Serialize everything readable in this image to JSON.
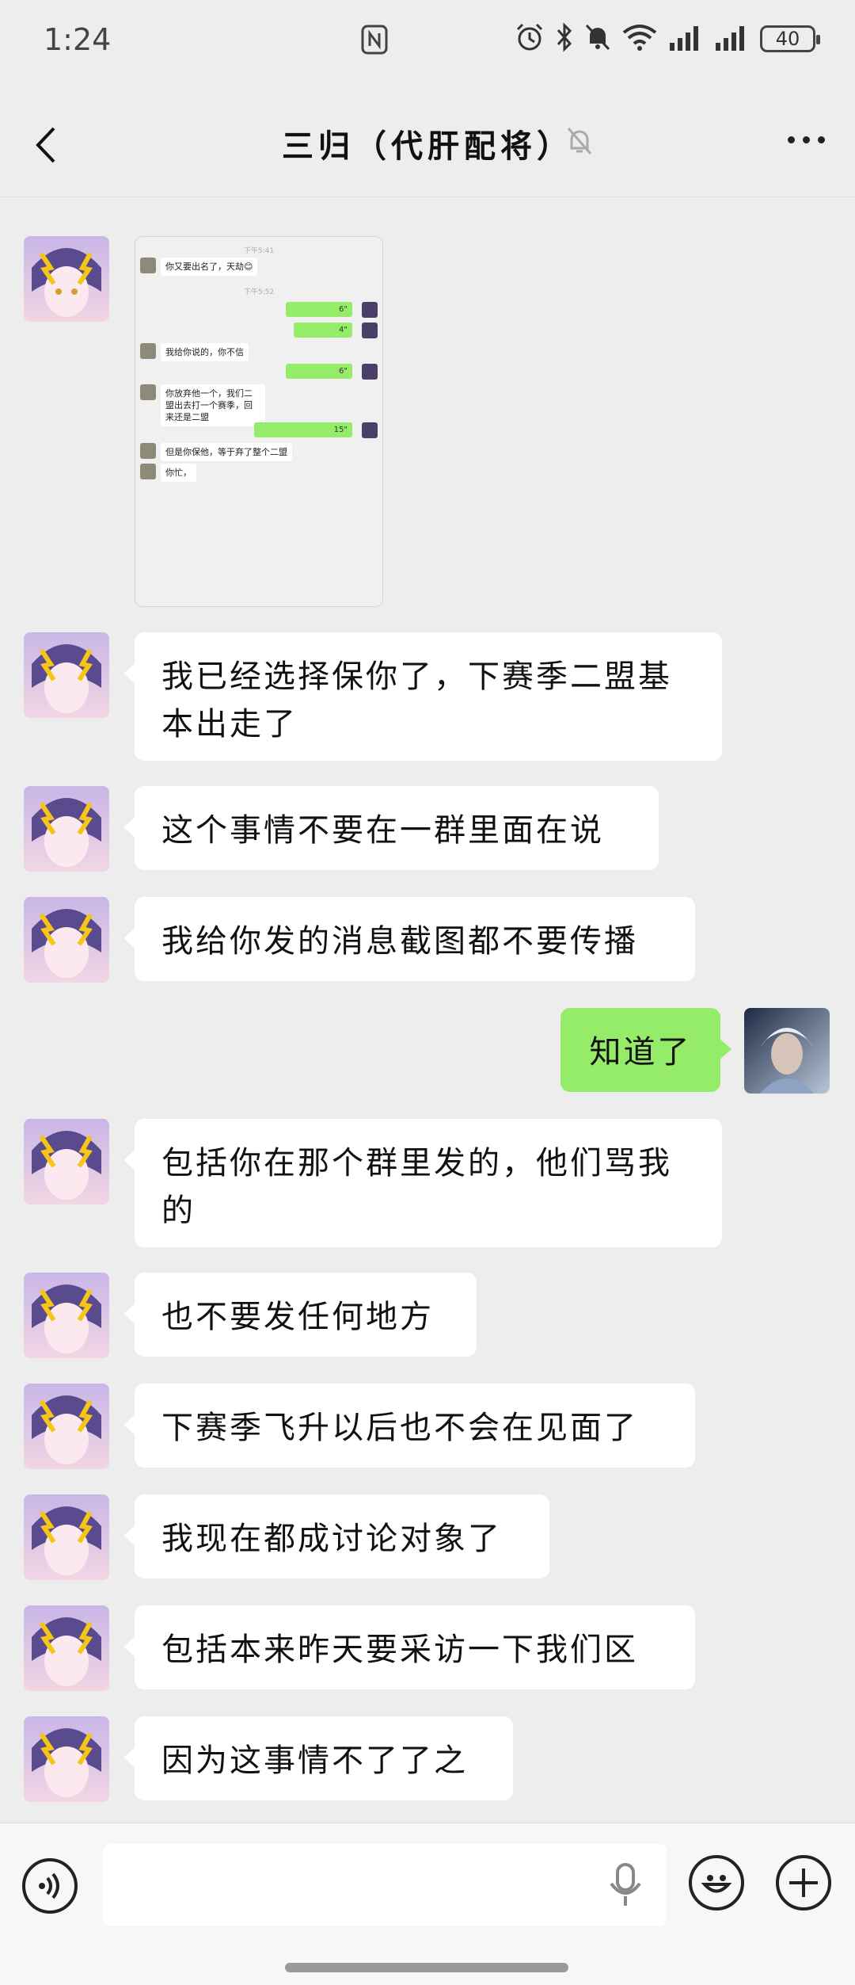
{
  "status_bar": {
    "time": "1:24",
    "battery": "40",
    "icons": [
      "nfc-icon",
      "alarm-icon",
      "bluetooth-icon",
      "bell-off-icon",
      "wifi-icon",
      "signal-icon",
      "signal-icon"
    ]
  },
  "header": {
    "title": "三归（代肝配将）",
    "muted": true
  },
  "screenshot_message": {
    "timestamp_1": "下午5:41",
    "timestamp_2": "下午5:52",
    "items": [
      {
        "side": "left",
        "text": "你又要出名了，天劫😊"
      },
      {
        "side": "right",
        "text": "6\""
      },
      {
        "side": "right",
        "text": "4\""
      },
      {
        "side": "left",
        "text": "我给你说的，你不信"
      },
      {
        "side": "right",
        "text": "6\""
      },
      {
        "side": "left",
        "text": "你放弃他一个，我们二盟出去打一个赛季，回来还是二盟"
      },
      {
        "side": "right",
        "text": "15\""
      },
      {
        "side": "left",
        "text": "但是你保他，等于弃了整个二盟"
      },
      {
        "side": "left",
        "text": "你忙，"
      }
    ]
  },
  "messages": [
    {
      "side": "left",
      "text": "我已经选择保你了，下赛季二盟基本出走了"
    },
    {
      "side": "left",
      "text": "这个事情不要在一群里面在说"
    },
    {
      "side": "left",
      "text": "我给你发的消息截图都不要传播"
    },
    {
      "side": "right",
      "text": "知道了"
    },
    {
      "side": "left",
      "text": "包括你在那个群里发的，他们骂我的"
    },
    {
      "side": "left",
      "text": "也不要发任何地方"
    },
    {
      "side": "left",
      "text": "下赛季飞升以后也不会在见面了"
    },
    {
      "side": "left",
      "text": "我现在都成讨论对象了"
    },
    {
      "side": "left",
      "text": "包括本来昨天要采访一下我们区"
    },
    {
      "side": "left",
      "text": "因为这事情不了了之"
    }
  ],
  "colors": {
    "background": "#ededed",
    "bubble_left": "#ffffff",
    "bubble_right": "#95ec69"
  },
  "bottom_bar": {
    "icons": [
      "voice-icon",
      "microphone-icon",
      "emoji-icon",
      "plus-icon"
    ]
  }
}
